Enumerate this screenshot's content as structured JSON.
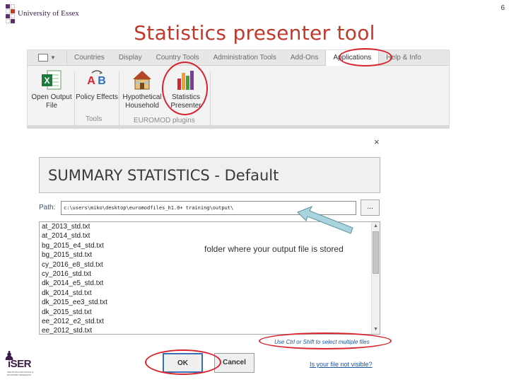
{
  "slide": {
    "number": "6",
    "title": "Statistics presenter tool",
    "logo_text": "University of Essex",
    "iser_logo_text": "iSER",
    "iser_subtext": "INSTITUTE FOR SOCIAL & ECONOMIC RESEARCH"
  },
  "ribbon": {
    "tabs": [
      "Countries",
      "Display",
      "Country Tools",
      "Administration Tools",
      "Add-Ons",
      "Applications",
      "Help & Info"
    ],
    "active_tab": "Applications",
    "buttons": {
      "open_output": "Open Output File",
      "policy_effects": "Policy Effects",
      "hypothetical_household": "Hypothetical Household",
      "statistics_presenter": "Statistics Presenter"
    },
    "groups": {
      "tools": "Tools",
      "plugins": "EUROMOD plugins"
    }
  },
  "dialog": {
    "close_glyph": "×",
    "title": "SUMMARY STATISTICS - Default",
    "path_label": "Path:",
    "path_value": "c:\\users\\miko\\desktop\\euromodfiles_h1.0+ training\\output\\",
    "browse_label": "...",
    "files": [
      "at_2013_std.txt",
      "at_2014_std.txt",
      "bg_2015_e4_std.txt",
      "bg_2015_std.txt",
      "cy_2016_e8_std.txt",
      "cy_2016_std.txt",
      "dk_2014_e5_std.txt",
      "dk_2014_std.txt",
      "dk_2015_ee3_std.txt",
      "dk_2015_std.txt",
      "ee_2012_e2_std.txt",
      "ee_2012_std.txt"
    ],
    "hint": "Use Ctrl or Shift to select multiple files",
    "ok_label": "OK",
    "cancel_label": "Cancel",
    "help_link": "Is your file not visible?"
  },
  "annotation": {
    "callout": "folder where your output file is stored"
  },
  "colors": {
    "title_red": "#c0392b",
    "annotation_red": "#d9232e",
    "arrow_fill": "#a8d4dd",
    "link_blue": "#1a55a0"
  }
}
